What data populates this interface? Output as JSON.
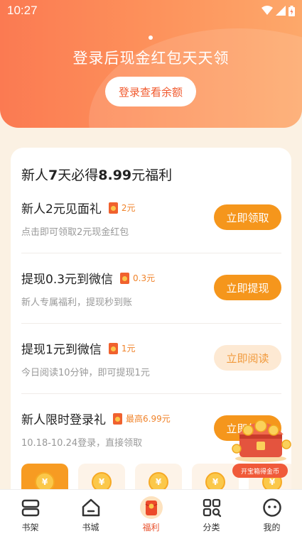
{
  "status_bar": {
    "time": "10:27"
  },
  "banner": {
    "title": "登录后现金红包天天领",
    "button_label": "登录查看余额"
  },
  "card": {
    "title_prefix": "新人",
    "title_num1": "7",
    "title_mid": "天必得",
    "title_num2": "8.99",
    "title_suffix": "元福利",
    "tasks": [
      {
        "name": "新人2元见面礼",
        "reward": "2元",
        "desc": "点击即可领取2元现金红包",
        "button": "立即领取",
        "enabled": true
      },
      {
        "name": "提现0.3元到微信",
        "reward": "0.3元",
        "desc": "新人专属福利，提现秒到账",
        "button": "立即提现",
        "enabled": true
      },
      {
        "name": "提现1元到微信",
        "reward": "1元",
        "desc": "今日阅读10分钟，即可提现1元",
        "button": "立即阅读",
        "enabled": false
      },
      {
        "name": "新人限时登录礼",
        "reward": "最高6.99元",
        "desc": "10.18-10.24登录，直接领取",
        "button": "立即领取",
        "enabled": true
      }
    ],
    "coin_symbol": "¥"
  },
  "chest": {
    "label": "开宝箱得金币"
  },
  "nav": {
    "items": [
      {
        "label": "书架",
        "icon": "bookshelf-icon"
      },
      {
        "label": "书城",
        "icon": "home-icon"
      },
      {
        "label": "福利",
        "icon": "red-envelope-icon"
      },
      {
        "label": "分类",
        "icon": "category-icon"
      },
      {
        "label": "我的",
        "icon": "profile-icon"
      }
    ],
    "active_index": 2
  },
  "colors": {
    "accent": "#f5961c",
    "brand_red": "#e8502c",
    "banner_start": "#fb7a52",
    "banner_end": "#fda86a"
  }
}
